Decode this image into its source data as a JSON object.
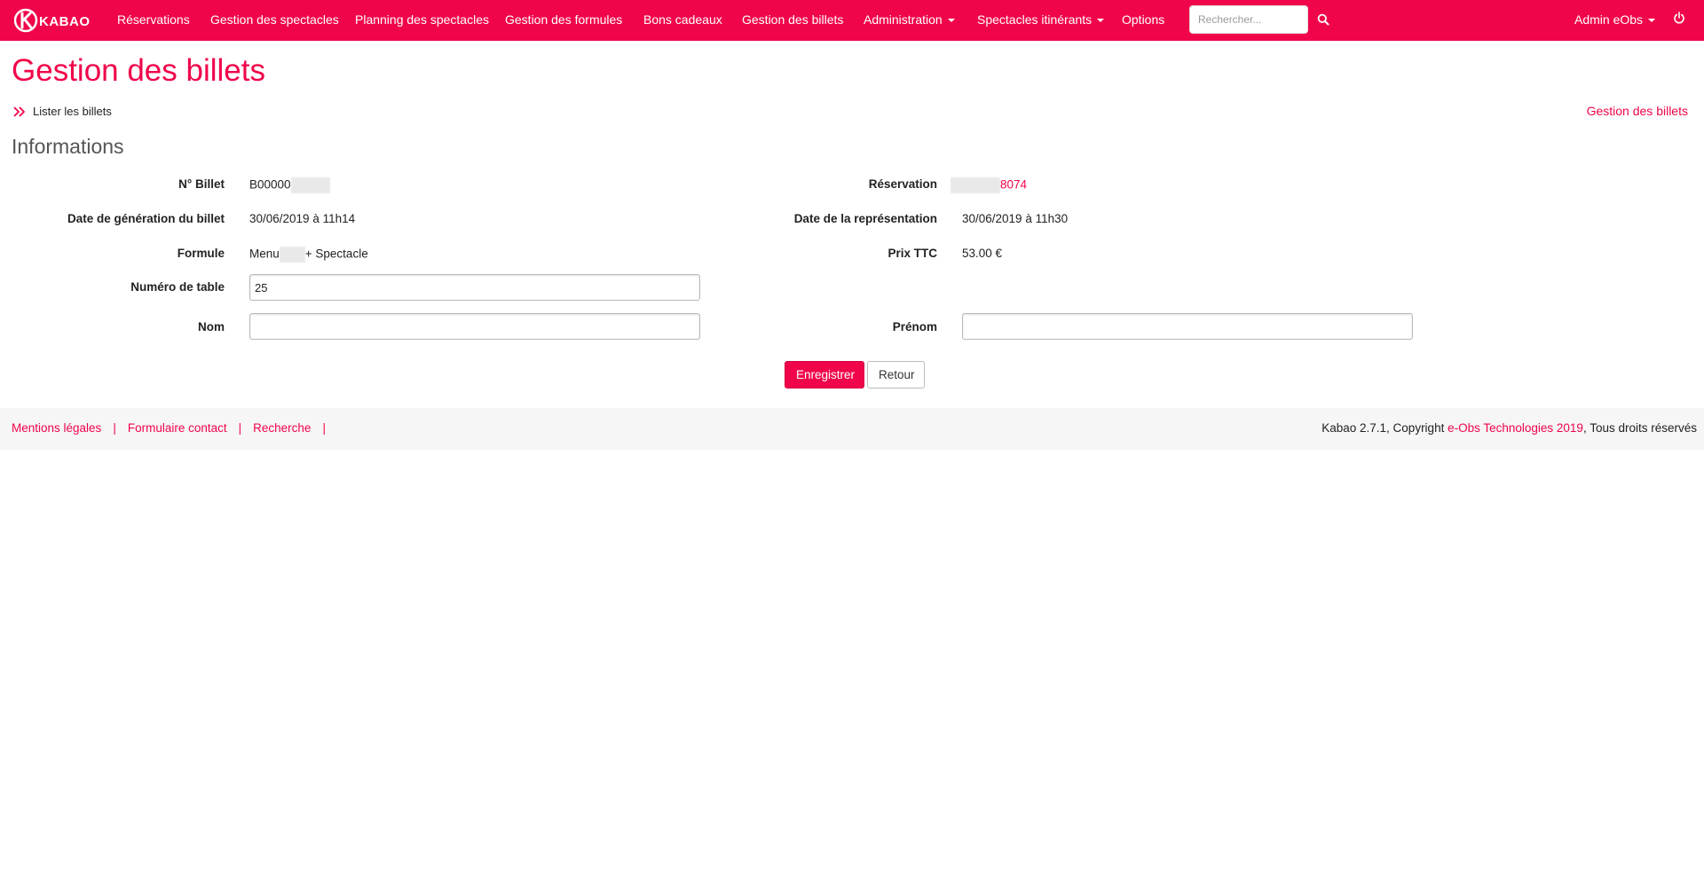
{
  "navbar": {
    "brand": "KABAO",
    "items": [
      {
        "label": "Réservations"
      },
      {
        "label": "Gestion des spectacles"
      },
      {
        "label": "Planning des spectacles"
      },
      {
        "label": "Gestion des formules"
      },
      {
        "label": "Bons cadeaux"
      },
      {
        "label": "Gestion des billets"
      },
      {
        "label": "Administration"
      },
      {
        "label": "Spectacles itinérants"
      },
      {
        "label": "Options"
      }
    ],
    "search_placeholder": "Rechercher...",
    "user_menu": "Admin eObs"
  },
  "page": {
    "title": "Gestion des billets",
    "breadcrumb_left": "Lister les billets",
    "breadcrumb_right": "Gestion des billets"
  },
  "section": {
    "title": "Informations"
  },
  "form": {
    "ticket_label": "N° Billet",
    "ticket_value": "B00000",
    "reservation_label": "Réservation",
    "reservation_value": "8074",
    "generation_label": "Date de génération du billet",
    "generation_value": "30/06/2019 à 11h14",
    "representation_label": "Date de la représentation",
    "representation_value": "30/06/2019 à 11h30",
    "formule_label": "Formule",
    "formule_value_prefix": "Menu",
    "formule_value_suffix": "+ Spectacle",
    "price_label": "Prix TTC",
    "price_value": "53.00 €",
    "table_label": "Numéro de table",
    "table_value": "25",
    "nom_label": "Nom",
    "nom_value": "",
    "prenom_label": "Prénom",
    "prenom_value": "",
    "save_label": "Enregistrer",
    "back_label": "Retour"
  },
  "footer": {
    "links": [
      {
        "label": "Mentions légales"
      },
      {
        "label": "Formulaire contact"
      },
      {
        "label": "Recherche"
      }
    ],
    "separator": "|",
    "copyright_prefix": "Kabao 2.7.1, Copyright ",
    "copyright_link": "e-Obs Technologies 2019",
    "copyright_suffix": ", Tous droits réservés"
  },
  "colors": {
    "accent": "#f0054a",
    "footer_bg": "#f6f6f6"
  }
}
